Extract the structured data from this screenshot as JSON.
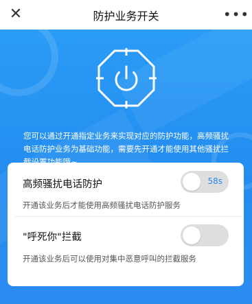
{
  "navbar": {
    "close_icon": "close-icon",
    "title": "防护业务开关",
    "more_icon": "more-icon"
  },
  "hero": {
    "icon": "power-shield-icon",
    "description": "您可以通过开通指定业务来实现对应的防护功能，高频骚扰电话防护业务为基础功能，需要先开通才能使用其他骚扰拦截设置功能哦~"
  },
  "services": [
    {
      "title": "高频骚扰电话防护",
      "subtitle": "开通该业务后才能使用高频骚扰电话防护服务",
      "enabled": false,
      "badge": "58s"
    },
    {
      "title": "\"呼死你\"拦截",
      "subtitle": "开通该业务后可以使用对集中恶意呼叫的拦截服务",
      "enabled": false
    }
  ],
  "colors": {
    "hero_blue": "#2693f3",
    "toggle_off": "#dedede",
    "badge_blue": "#2f86f2"
  }
}
